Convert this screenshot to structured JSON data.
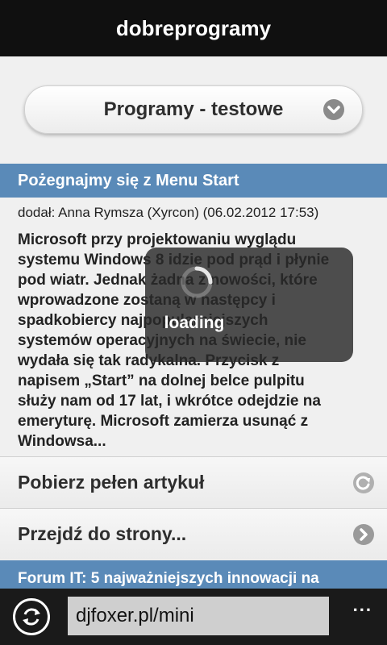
{
  "header": {
    "title": "dobreprogramy"
  },
  "category_select": {
    "selected": "Programy - testowe",
    "icon": "chevron-down-icon"
  },
  "article": {
    "title": "Pożegnajmy się z Menu Start",
    "meta": "dodał: Anna Rymsza (Xyrcon) (06.02.2012 17:53)",
    "body_lines": [
      "Microsoft przy projektowaniu wyglądu",
      "systemu Windows 8 idzie pod prąd i płynie",
      "pod wiatr. Jednak żadna z nowości, które",
      "wprowadzone zostaną w następcy i",
      "spadkobiercy najpopularniejszych",
      "systemów operacyjnych na świecie, nie",
      "wydała się tak radykalna. Przycisk z",
      "napisem „Start” na dolnej belce pulpitu",
      "służy nam od 17 lat, i wkrótce odejdzie na",
      "emeryturę. Microsoft zamierza usunąć z",
      "Windowsa..."
    ]
  },
  "actions": {
    "full_article": "Pobierz pełen artykuł",
    "go_to_page": "Przejdź do strony..."
  },
  "next_article": {
    "title": "Forum IT: 5 najważniejszych innowacji na"
  },
  "loading": {
    "text": "loading"
  },
  "appbar": {
    "refresh_icon": "refresh-icon",
    "address": "djfoxer.pl/mini",
    "more": "..."
  },
  "colors": {
    "header_bg": "#101010",
    "article_bar": "#5a8ab8",
    "appbar_bg": "#1a1a1a"
  }
}
